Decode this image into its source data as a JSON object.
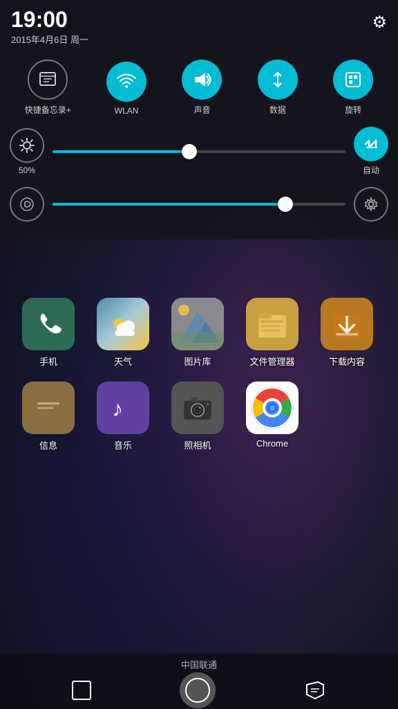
{
  "statusBar": {
    "time": "19:00",
    "date": "2015年4月6日 周一"
  },
  "settingsIcon": "⚙",
  "quickToggles": [
    {
      "id": "quick-backup",
      "label": "快捷备忘录+",
      "active": false,
      "icon": "⊟"
    },
    {
      "id": "wlan",
      "label": "WLAN",
      "active": true,
      "icon": "WiFi"
    },
    {
      "id": "sound",
      "label": "声音",
      "active": true,
      "icon": "🔊"
    },
    {
      "id": "data",
      "label": "数据",
      "active": true,
      "icon": "⇅"
    },
    {
      "id": "rotate",
      "label": "旋转",
      "active": true,
      "icon": "Rotate"
    }
  ],
  "brightness": {
    "percent": "50%",
    "sliderFillWidth": "48%",
    "thumbPosition": "46%",
    "autoLabel": "自动"
  },
  "volume": {
    "sliderFillWidth": "80%",
    "thumbPosition": "78%"
  },
  "appRows": [
    [
      {
        "id": "phone",
        "label": "手机",
        "iconClass": "icon-phone",
        "icon": "📞"
      },
      {
        "id": "weather",
        "label": "天气",
        "iconClass": "icon-weather",
        "icon": "Weather"
      },
      {
        "id": "gallery",
        "label": "图片库",
        "iconClass": "icon-gallery",
        "icon": "Gallery"
      },
      {
        "id": "files",
        "label": "文件管理器",
        "iconClass": "icon-files",
        "icon": "📁"
      },
      {
        "id": "downloads",
        "label": "下载内容",
        "iconClass": "icon-downloads",
        "icon": "⬇"
      }
    ],
    [
      {
        "id": "messages",
        "label": "信息",
        "iconClass": "icon-messages",
        "icon": "💬"
      },
      {
        "id": "music",
        "label": "音乐",
        "iconClass": "icon-music",
        "icon": "♪"
      },
      {
        "id": "camera",
        "label": "照相机",
        "iconClass": "icon-camera",
        "icon": "Camera"
      },
      {
        "id": "chrome",
        "label": "Chrome",
        "iconClass": "icon-chrome",
        "icon": "Chrome"
      }
    ]
  ],
  "carrier": "中国联通",
  "nav": {
    "recent": "recent",
    "home": "home",
    "menu": "menu"
  }
}
